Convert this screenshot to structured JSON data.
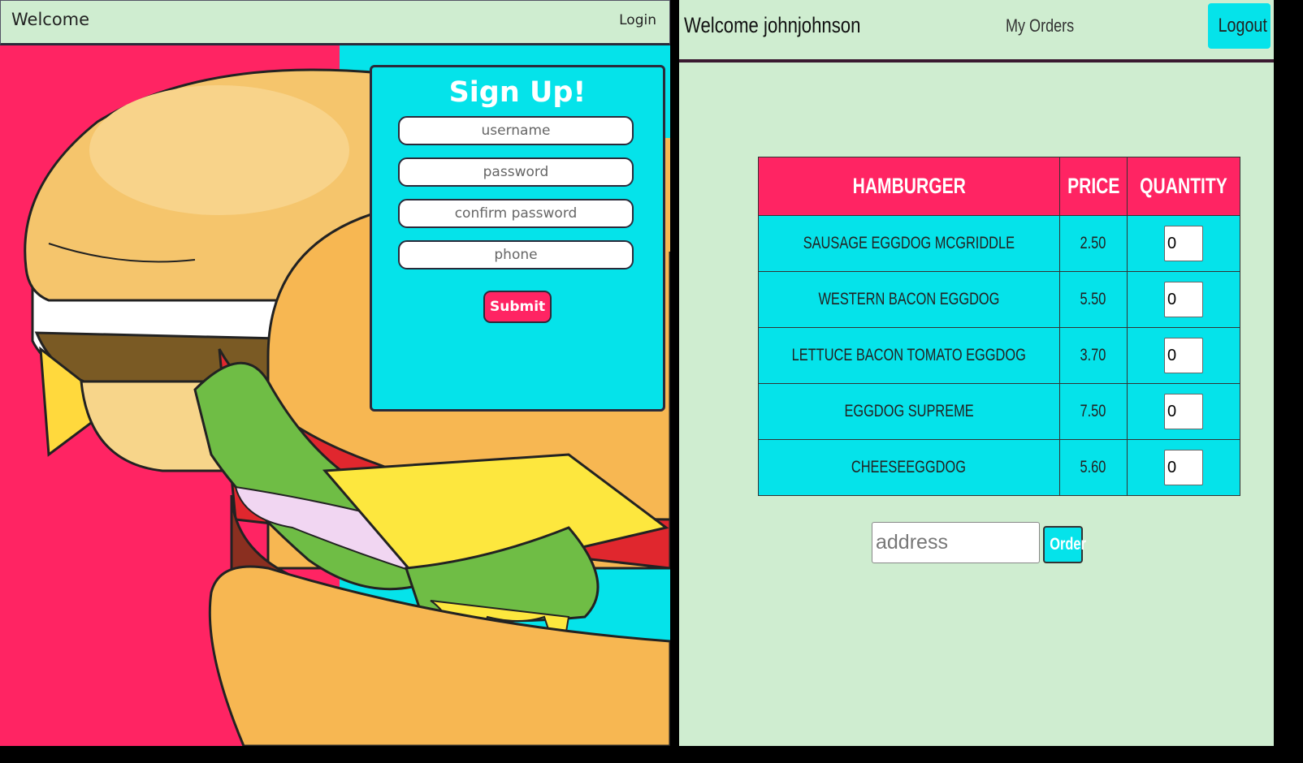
{
  "signup_page": {
    "nav": {
      "brand": "Welcome",
      "login_label": "Login"
    },
    "form": {
      "title": "Sign Up!",
      "username_placeholder": "username",
      "password_placeholder": "password",
      "confirm_placeholder": "confirm password",
      "phone_placeholder": "phone",
      "submit_label": "Submit"
    }
  },
  "order_page": {
    "nav": {
      "welcome": "Welcome johnjohnson",
      "orders_label": "My Orders",
      "logout_label": "Logout"
    },
    "table": {
      "headers": [
        "HAMBURGER",
        "PRICE",
        "QUANTITY"
      ],
      "rows": [
        {
          "name": "SAUSAGE EGGDOG MCGRIDDLE",
          "price": "2.50",
          "qty": "0"
        },
        {
          "name": "WESTERN BACON EGGDOG",
          "price": "5.50",
          "qty": "0"
        },
        {
          "name": "LETTUCE BACON TOMATO EGGDOG",
          "price": "3.70",
          "qty": "0"
        },
        {
          "name": "EGGDOG SUPREME",
          "price": "7.50",
          "qty": "0"
        },
        {
          "name": "CHEESEEGGDOG",
          "price": "5.60",
          "qty": "0"
        }
      ]
    },
    "address_placeholder": "address",
    "order_label": "Order"
  },
  "colors": {
    "pink": "#ff2463",
    "cyan": "#05e3ea",
    "mint": "#cfedd0",
    "bun": "#f7b752",
    "dark": "#2a2a3a"
  }
}
